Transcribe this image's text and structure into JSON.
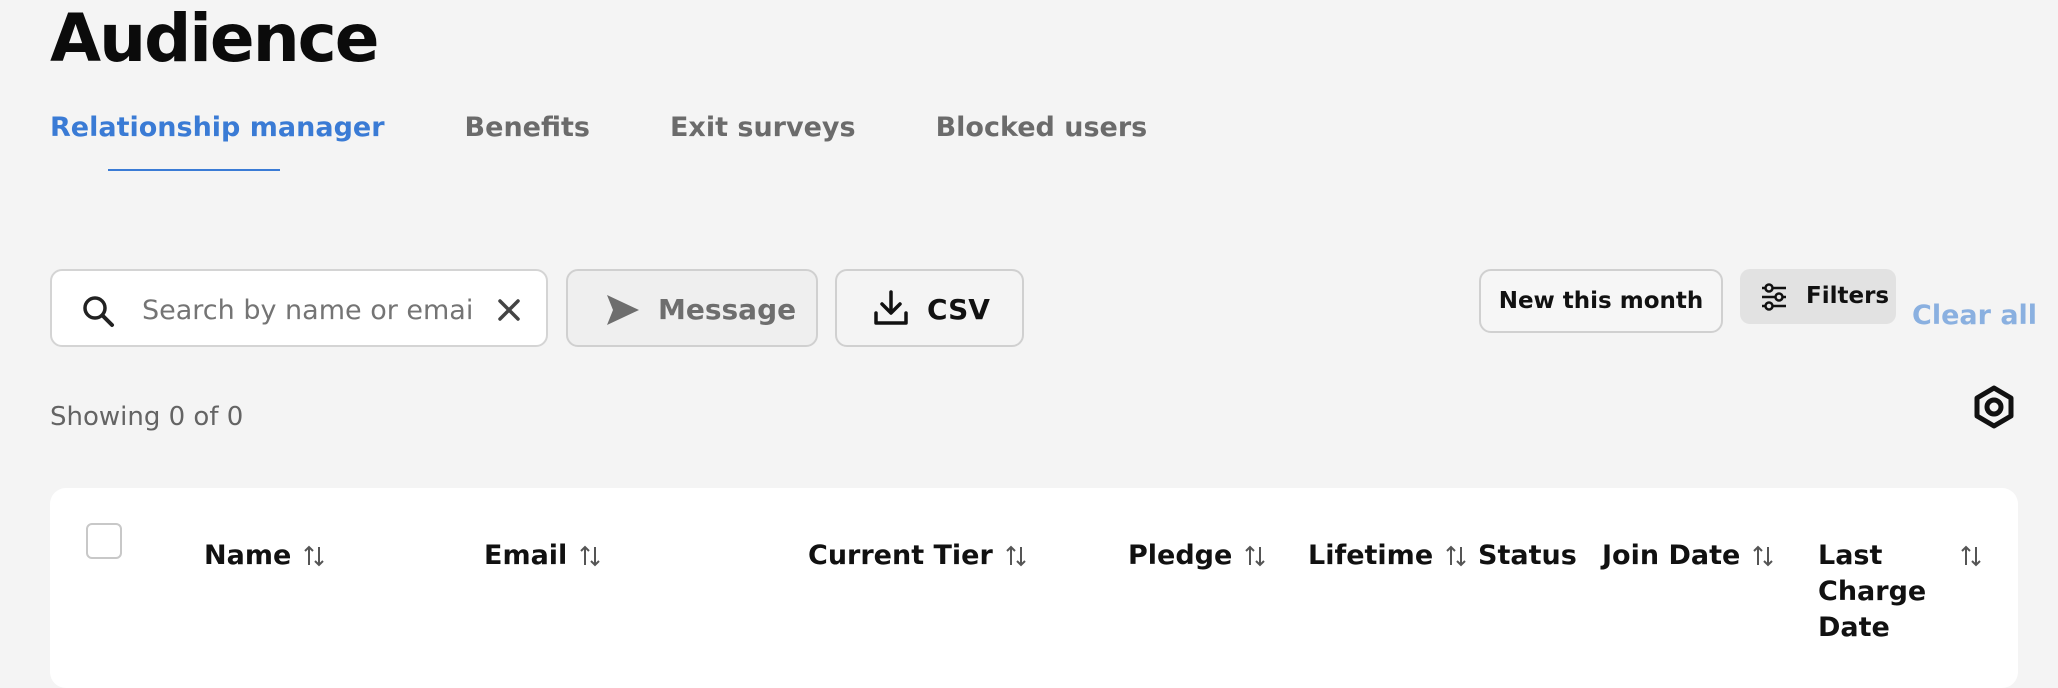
{
  "page": {
    "title": "Audience"
  },
  "tabs": [
    {
      "label": "Relationship manager",
      "active": true
    },
    {
      "label": "Benefits",
      "active": false
    },
    {
      "label": "Exit surveys",
      "active": false
    },
    {
      "label": "Blocked users",
      "active": false
    }
  ],
  "toolbar": {
    "search": {
      "placeholder": "Search by name or email",
      "value": "",
      "icon": "search-icon",
      "clear_icon": "close-icon"
    },
    "message_label": "Message",
    "message_icon": "send-icon",
    "csv_label": "CSV",
    "csv_icon": "download-icon",
    "new_this_month_label": "New this month",
    "filters_label": "Filters",
    "filters_icon": "sliders-icon",
    "clear_all_label": "Clear all"
  },
  "results": {
    "showing_text": "Showing 0 of 0",
    "settings_icon": "gear-icon"
  },
  "table": {
    "columns": [
      {
        "label": "Name",
        "sortable": true
      },
      {
        "label": "Email",
        "sortable": true
      },
      {
        "label": "Current Tier",
        "sortable": true
      },
      {
        "label": "Pledge",
        "sortable": true
      },
      {
        "label": "Lifetime",
        "sortable": true
      },
      {
        "label": "Status",
        "sortable": false
      },
      {
        "label": "Join Date",
        "sortable": true
      },
      {
        "label": "Last Charge Date",
        "sortable": true
      }
    ],
    "rows": []
  },
  "colors": {
    "accent": "#3a7bd5",
    "clear_all": "#8ab0e0",
    "background": "#f4f4f4"
  }
}
